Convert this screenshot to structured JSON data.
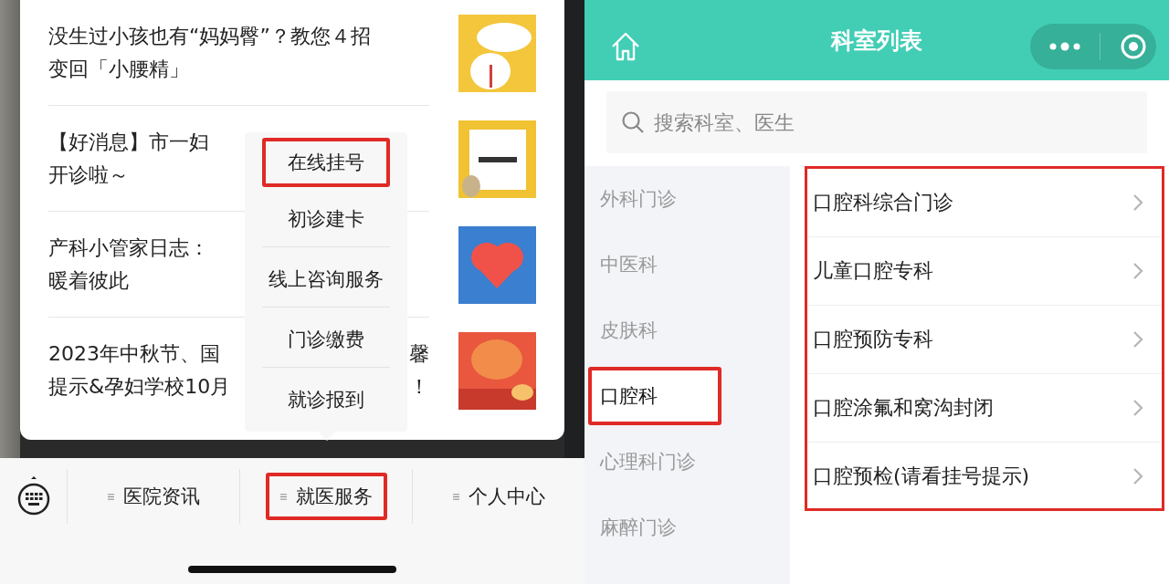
{
  "left": {
    "articles": [
      {
        "lines": [
          {
            "left": "没生过小孩也有“妈妈臀”？教您４招"
          },
          {
            "left": "变回「小腰精」"
          }
        ],
        "thumbnail": {
          "kind": "picture"
        }
      },
      {
        "lines": [
          {
            "left": "【好消息】市一妇"
          },
          {
            "left": "开诊啦～"
          }
        ],
        "thumbnail": {
          "kind": "picture"
        }
      },
      {
        "lines": [
          {
            "left": "产科小管家日志："
          },
          {
            "left": "暖着彼此"
          }
        ],
        "thumbnail": {
          "kind": "picture"
        }
      },
      {
        "lines": [
          {
            "left": "2023年中秋节、国",
            "right": "馨"
          },
          {
            "left": "提示&孕妇学校10月",
            "right": "！"
          }
        ],
        "thumbnail": {
          "kind": "picture"
        }
      }
    ],
    "popup_menu": [
      {
        "label": "在线挂号",
        "highlighted": true
      },
      {
        "label": "初诊建卡",
        "highlighted": false
      },
      {
        "label": "线上咨询服务",
        "highlighted": false
      },
      {
        "label": "门诊缴费",
        "highlighted": false
      },
      {
        "label": "就诊报到",
        "highlighted": false
      }
    ],
    "tab_bar": [
      {
        "label": "医院资讯",
        "highlighted": false
      },
      {
        "label": "就医服务",
        "highlighted": true
      },
      {
        "label": "个人中心",
        "highlighted": false
      }
    ]
  },
  "right": {
    "title": "科室列表",
    "search": {
      "placeholder": "搜索科室、医生"
    },
    "departments": [
      {
        "label": "外科门诊",
        "selected": false,
        "highlighted": false
      },
      {
        "label": "中医科",
        "selected": false,
        "highlighted": false
      },
      {
        "label": "皮肤科",
        "selected": false,
        "highlighted": false
      },
      {
        "label": "口腔科",
        "selected": true,
        "highlighted": true
      },
      {
        "label": "心理科门诊",
        "selected": false,
        "highlighted": false
      },
      {
        "label": "麻醉门诊",
        "selected": false,
        "highlighted": false
      }
    ],
    "clinics_highlighted": true,
    "clinics": [
      {
        "label": "口腔科综合门诊"
      },
      {
        "label": "儿童口腔专科"
      },
      {
        "label": "口腔预防专科"
      },
      {
        "label": "口腔涂氟和窝沟封闭"
      },
      {
        "label": "口腔预检(请看挂号提示)"
      }
    ]
  }
}
